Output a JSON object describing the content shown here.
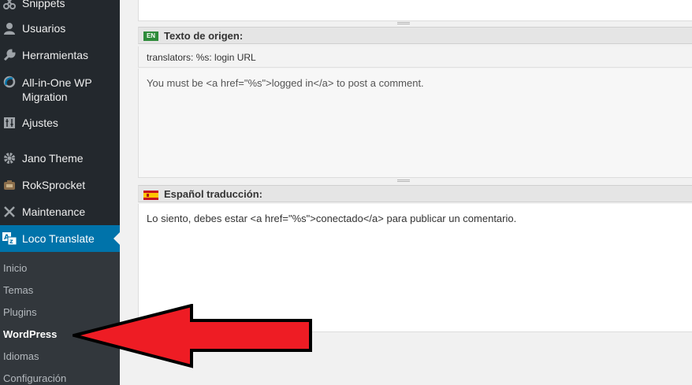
{
  "sidebar": {
    "items": [
      {
        "label": "Snippets",
        "icon": "scissors-icon"
      },
      {
        "label": "Usuarios",
        "icon": "users-icon"
      },
      {
        "label": "Herramientas",
        "icon": "wrench-icon"
      },
      {
        "label": "All-in-One WP",
        "label2": "Migration",
        "icon": "migration-icon"
      },
      {
        "label": "Ajustes",
        "icon": "settings-icon"
      },
      {
        "label": "Jano Theme",
        "icon": "gear-icon"
      },
      {
        "label": "RokSprocket",
        "icon": "rocket-icon"
      },
      {
        "label": "Maintenance",
        "icon": "tools-icon"
      },
      {
        "label": "Loco Translate",
        "icon": "translate-icon"
      }
    ],
    "submenu": [
      "Inicio",
      "Temas",
      "Plugins",
      "WordPress",
      "Idiomas",
      "Configuración"
    ],
    "current_submenu": "WordPress"
  },
  "editor": {
    "source_header": {
      "lang_badge": "EN",
      "title": "Texto de origen:"
    },
    "context": "translators: %s: login URL",
    "source_text": "You must be <a href=\"%s\">logged in</a> to post a comment.",
    "target_header": {
      "title": "Español traducción:"
    },
    "target_text": "Lo siento, debes estar <a href=\"%s\">conectado</a> para publicar un comentario."
  },
  "colors": {
    "admin_bar": "#23282d",
    "active_menu": "#0073aa",
    "arrow": "#ee1c24"
  }
}
